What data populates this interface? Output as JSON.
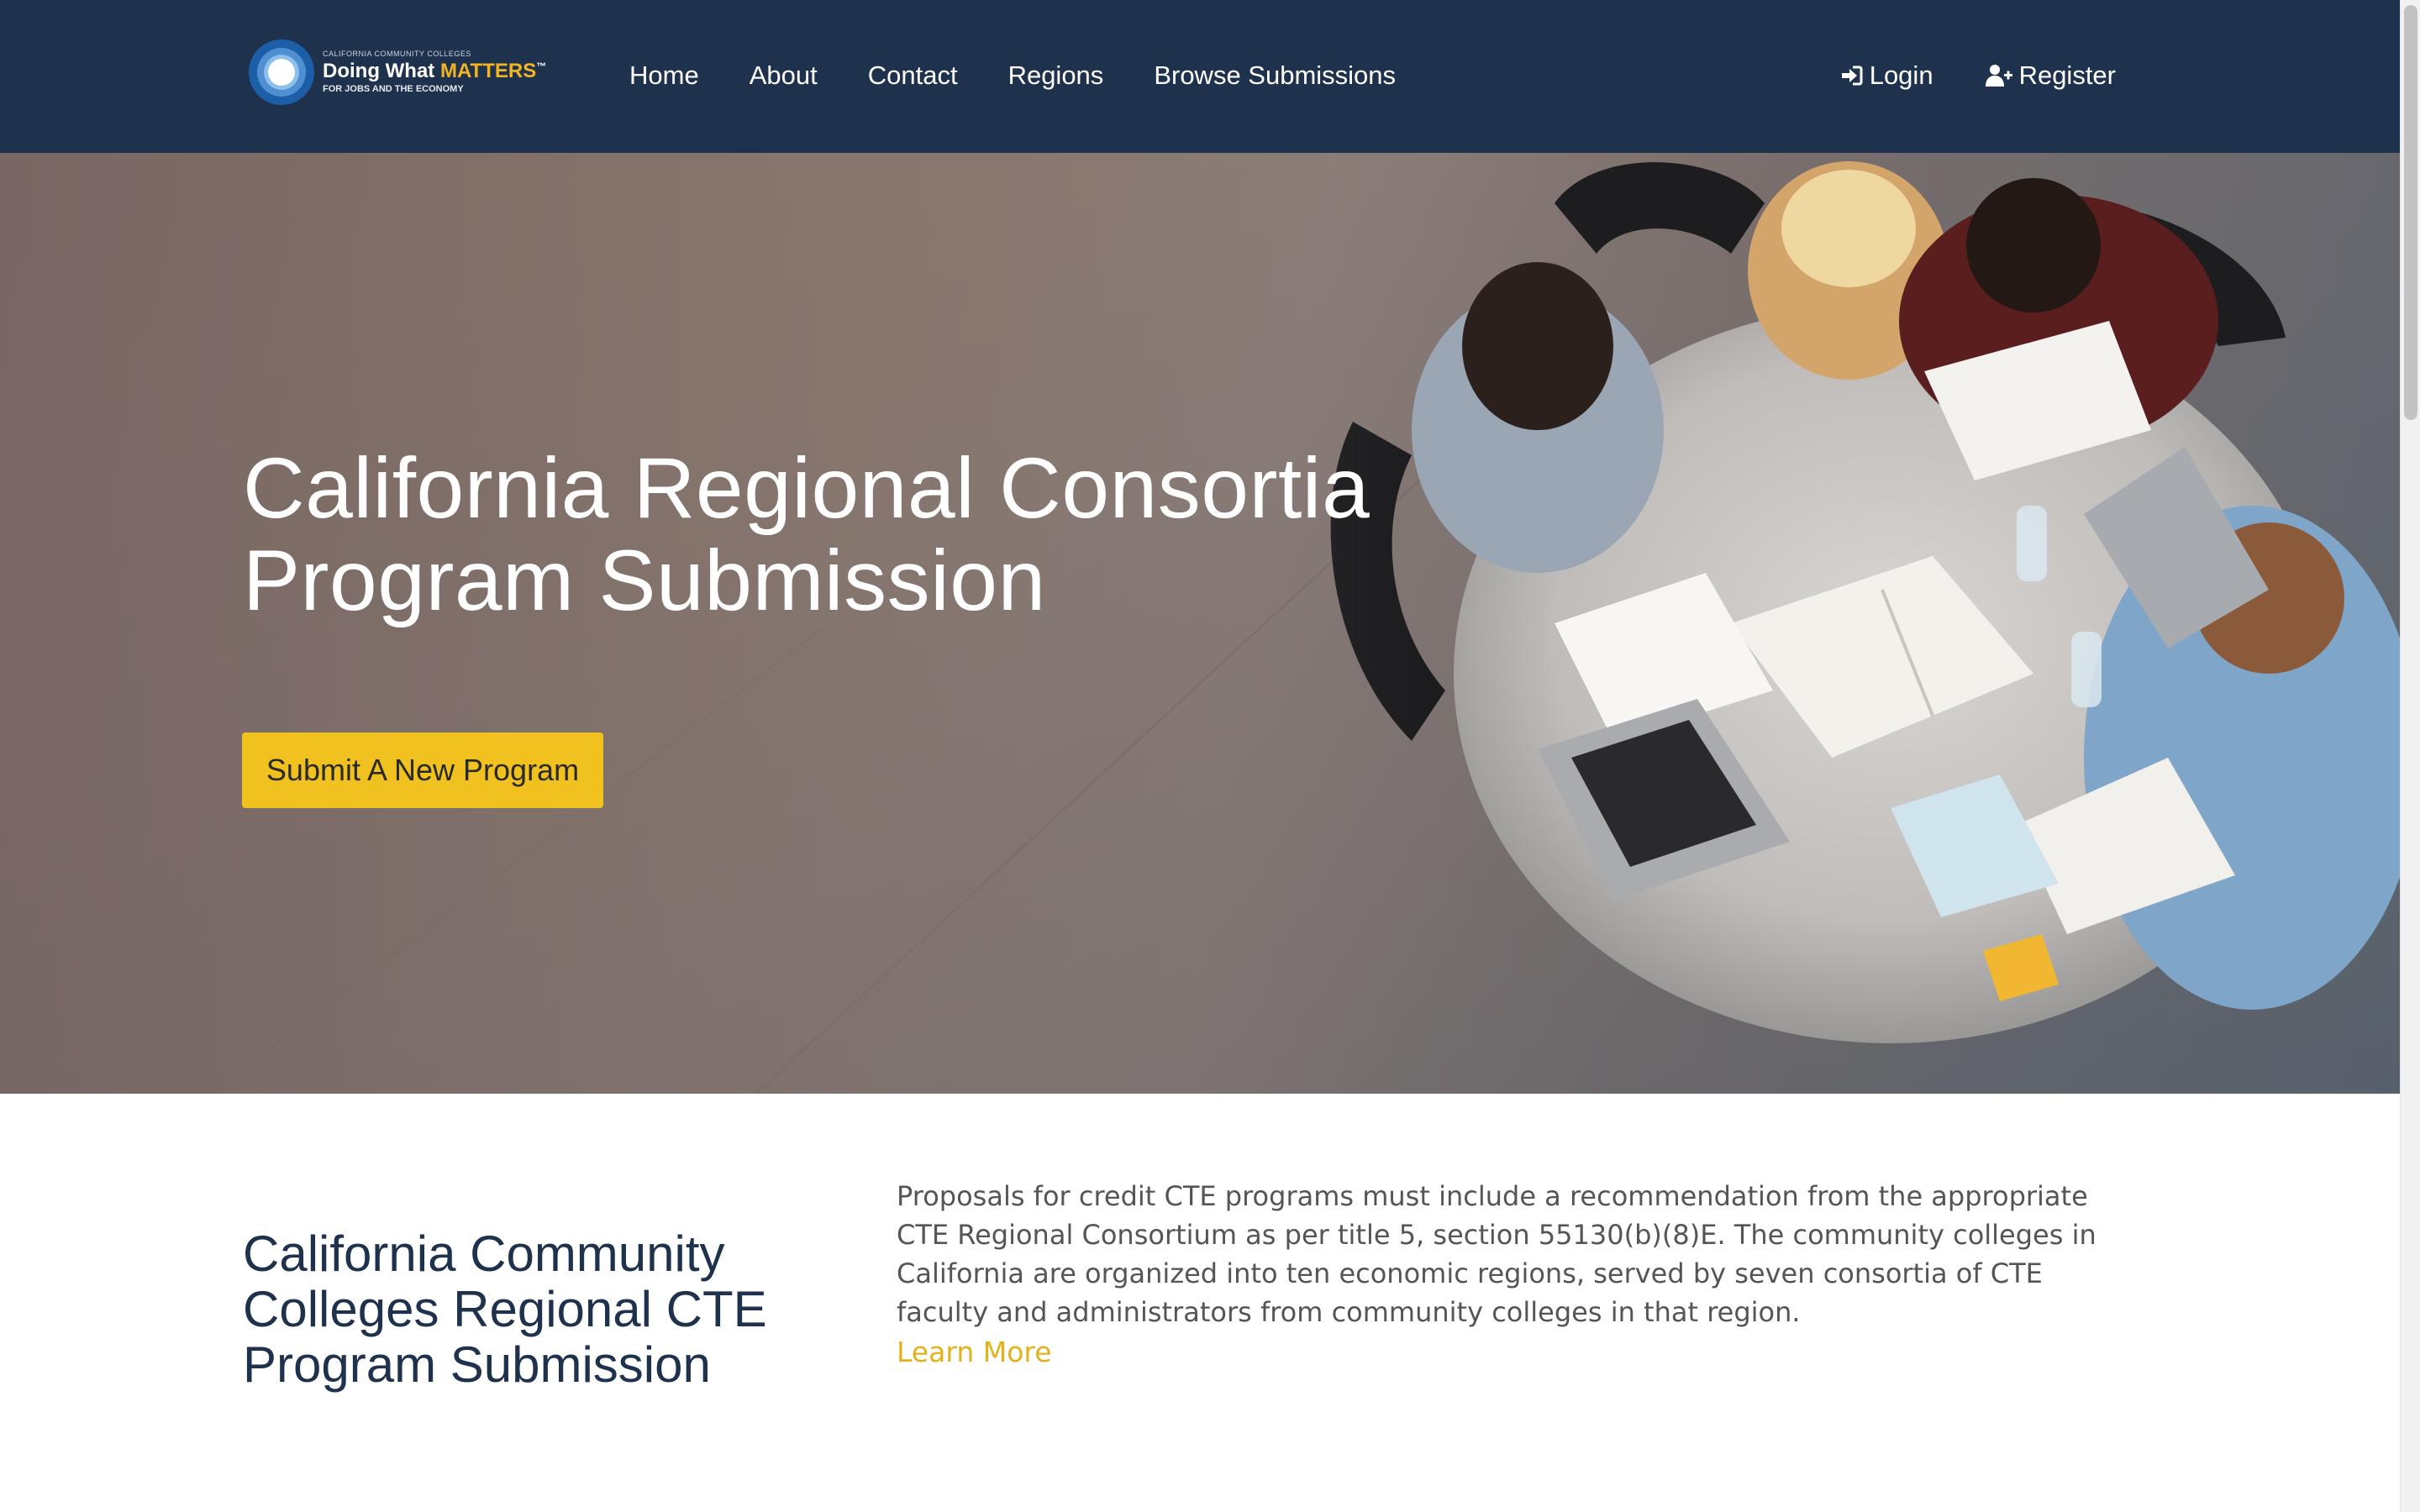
{
  "logo": {
    "small_text": "CALIFORNIA COMMUNITY COLLEGES",
    "main_text": "Doing What",
    "main_highlight": "MATTERS",
    "trademark": "™",
    "sub_text": "FOR JOBS AND THE ECONOMY",
    "icon": "doing-what-matters-logo-icon"
  },
  "nav": {
    "items": [
      {
        "label": "Home"
      },
      {
        "label": "About"
      },
      {
        "label": "Contact"
      },
      {
        "label": "Regions"
      },
      {
        "label": "Browse Submissions"
      }
    ],
    "login": {
      "label": "Login",
      "icon": "sign-in-icon"
    },
    "register": {
      "label": "Register",
      "icon": "user-plus-icon"
    }
  },
  "hero": {
    "title_line1": "California Regional Consortia",
    "title_line2": "Program Submission",
    "cta_label": "Submit A New Program",
    "image": "students-studying-at-table-photo"
  },
  "content": {
    "title": "California Community Colleges Regional CTE Program Submission",
    "body": "Proposals for credit CTE programs must include a recommendation from the appropriate CTE Regional Consortium as per title 5, section 55130(b)(8)E. The community colleges in California are organized into ten economic regions, served by seven consortia of CTE faculty and administrators from community colleges in that region.",
    "learn_more": "Learn More"
  },
  "colors": {
    "navbar": "#1f324d",
    "accent": "#f1c21f",
    "link": "#e3b21b",
    "heading": "#1f324d",
    "body_text": "#555555"
  }
}
